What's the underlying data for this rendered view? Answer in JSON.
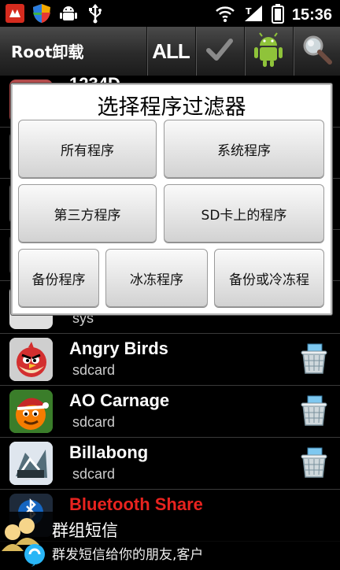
{
  "status_bar": {
    "time": "15:36",
    "left_icons": [
      "app-notification-icon",
      "shield-icon",
      "android-debug-icon",
      "usb-icon"
    ],
    "right_icons": [
      "wifi-icon",
      "signal-icon",
      "battery-icon"
    ]
  },
  "title_bar": {
    "title": "Root卸载",
    "all_label": "ALL"
  },
  "list": {
    "partial_top": {
      "name": "1234D"
    },
    "items": [
      {
        "name": "",
        "location": "sys"
      },
      {
        "name": "Angry Birds",
        "location": "sdcard"
      },
      {
        "name": "AO Carnage",
        "location": "sdcard"
      },
      {
        "name": "Billabong",
        "location": "sdcard"
      },
      {
        "name": "Bluetooth Share",
        "location": ""
      }
    ]
  },
  "dialog": {
    "title": "选择程序过滤器",
    "buttons": [
      "所有程序",
      "系统程序",
      "第三方程序",
      "SD卡上的程序",
      "备份程序",
      "冰冻程序",
      "备份或冷冻程"
    ]
  },
  "ad": {
    "title": "群组短信",
    "subtitle": "群发短信给你的朋友,客户"
  },
  "colors": {
    "bluetooth_name": "#e8231f",
    "titlebar": "#2b2b2b",
    "dialog_bg": "#ffffff"
  }
}
